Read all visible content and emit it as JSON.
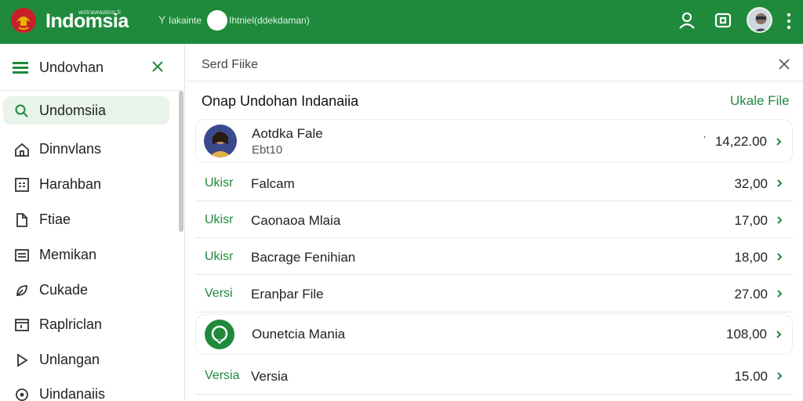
{
  "topbar": {
    "brand_small": "wstrawaatoo ti",
    "title": "Indomsia",
    "filter_glyph": "Y",
    "filter_label": "Iakainte",
    "status_text": "Ihtniel(ddekdaman)",
    "icons": [
      "user-icon",
      "wallet-icon",
      "avatar",
      "more-vertical-icon"
    ],
    "accent": "#1f8a3c"
  },
  "sidebar": {
    "title": "Undovhan",
    "items": [
      {
        "label": "Undomsiia",
        "icon": "search-icon",
        "active": true
      },
      {
        "label": "Dinnvlans",
        "icon": "home-icon",
        "active": false
      },
      {
        "label": "Harahban",
        "icon": "grid-icon",
        "active": false
      },
      {
        "label": "Ftiae",
        "icon": "file-icon",
        "active": false
      },
      {
        "label": "Memikan",
        "icon": "list-icon",
        "active": false
      },
      {
        "label": "Cukade",
        "icon": "leaf-icon",
        "active": false
      },
      {
        "label": "Raplriclan",
        "icon": "folder-icon",
        "active": false
      },
      {
        "label": "Unlangan",
        "icon": "play-icon",
        "active": false
      },
      {
        "label": "Uindanaiis",
        "icon": "clock-icon",
        "active": false
      }
    ]
  },
  "main": {
    "header_title": "Serd Fiike",
    "section_title": "Onap Undohan Indanaiia",
    "section_link": "Ukale File",
    "rows": [
      {
        "kind": "card-avatar",
        "name": "Aotdka Fale",
        "sub": "Ebt10",
        "value": "14,22.00",
        "prefix": "ʼ"
      },
      {
        "kind": "tag",
        "tag": "Ukisr",
        "name": "Falcam",
        "value": "32,00"
      },
      {
        "kind": "tag",
        "tag": "Ukisr",
        "name": "Caonaoa Mlaia",
        "value": "17,00"
      },
      {
        "kind": "tag",
        "tag": "Ukisr",
        "name": "Bacrage Fenihian",
        "value": "18,00"
      },
      {
        "kind": "tag",
        "tag": "Versi",
        "name": "Eranþar File",
        "value": "27.00"
      },
      {
        "kind": "card-icon",
        "name": "Ounetcia Mania",
        "value": "108,00"
      },
      {
        "kind": "tag",
        "tag": "Versia",
        "name": "Versia",
        "value": "15.00"
      }
    ]
  }
}
